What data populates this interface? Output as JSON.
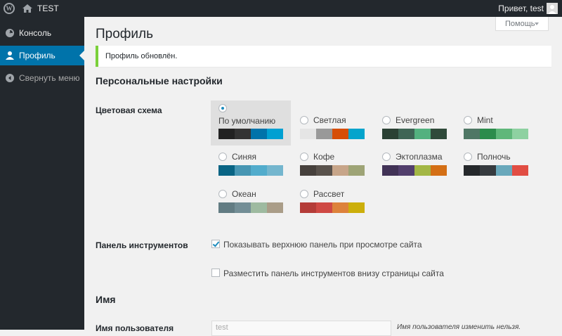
{
  "adminbar": {
    "site_name": "TEST",
    "howdy": "Привет, test",
    "icons": {
      "logo": "wordpress-icon",
      "home": "home-icon",
      "avatar": "avatar"
    }
  },
  "sidebar": {
    "items": [
      {
        "label": "Консоль",
        "icon": "dashboard-icon"
      },
      {
        "label": "Профиль",
        "icon": "user-icon",
        "active": true
      },
      {
        "label": "Свернуть меню",
        "icon": "collapse-icon"
      }
    ],
    "colors": {
      "background": "#23282d",
      "active": "#0073aa"
    }
  },
  "help_tab": {
    "label": "Помощь"
  },
  "page": {
    "title": "Профиль",
    "notice": "Профиль обновлён.",
    "section_personal": "Персональные настройки",
    "section_name": "Имя"
  },
  "color_scheme": {
    "label": "Цветовая схема",
    "selected": "По умолчанию",
    "schemes": [
      {
        "name": "По умолчанию",
        "colors": [
          "#222222",
          "#333333",
          "#0073aa",
          "#00a0d2"
        ]
      },
      {
        "name": "Светлая",
        "colors": [
          "#e5e5e5",
          "#999999",
          "#d64e07",
          "#04a4cc"
        ]
      },
      {
        "name": "Evergreen",
        "colors": [
          "#2b4134",
          "#3e6555",
          "#53b17f",
          "#2f4a3a"
        ]
      },
      {
        "name": "Mint",
        "colors": [
          "#4f7765",
          "#2c8c4c",
          "#5fb77a",
          "#8ed1a1"
        ]
      },
      {
        "name": "Синяя",
        "colors": [
          "#096484",
          "#4796b3",
          "#52accc",
          "#74b6ce"
        ]
      },
      {
        "name": "Кофе",
        "colors": [
          "#46403c",
          "#59524c",
          "#c7a589",
          "#9ea476"
        ]
      },
      {
        "name": "Эктоплазма",
        "colors": [
          "#413256",
          "#523f6d",
          "#a3b745",
          "#d46f15"
        ]
      },
      {
        "name": "Полночь",
        "colors": [
          "#25282b",
          "#363b3f",
          "#69a8bb",
          "#e14d43"
        ]
      },
      {
        "name": "Океан",
        "colors": [
          "#627c83",
          "#738e96",
          "#9ebaa0",
          "#aa9d88"
        ]
      },
      {
        "name": "Рассвет",
        "colors": [
          "#b43c38",
          "#cf4944",
          "#dd823b",
          "#ccaf0b"
        ]
      }
    ]
  },
  "toolbar": {
    "label": "Панель инструментов",
    "show_toolbar": {
      "label": "Показывать верхнюю панель при просмотре сайта",
      "checked": true
    },
    "toolbar_bottom": {
      "label": "Разместить панель инструментов внизу страницы сайта",
      "checked": false
    }
  },
  "username": {
    "label": "Имя пользователя",
    "value": "test",
    "note": "Имя пользователя изменить нельзя."
  }
}
